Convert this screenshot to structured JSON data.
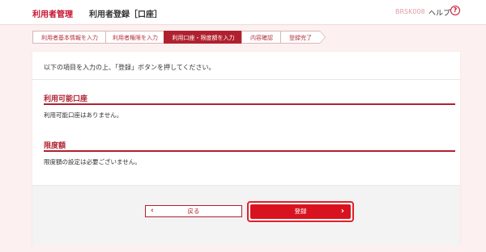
{
  "header": {
    "app_title": "利用者管理",
    "page_title": "利用者登録［口座］",
    "screen_id": "BRSK008",
    "help_label": "ヘルプ",
    "help_icon": "?"
  },
  "steps": [
    {
      "label": "利用者基本情報を入力",
      "active": false
    },
    {
      "label": "利用者権限を入力",
      "active": false
    },
    {
      "label": "利用口座・限度額を入力",
      "active": true
    },
    {
      "label": "内容確認",
      "active": false
    },
    {
      "label": "登録完了",
      "active": false
    }
  ],
  "intro_text": "以下の項目を入力の上、「登録」ボタンを押してください。",
  "sections": {
    "accounts": {
      "title": "利用可能口座",
      "text": "利用可能口座はありません。"
    },
    "limits": {
      "title": "限度額",
      "text": "限度額の設定は必要ございません。"
    }
  },
  "buttons": {
    "back_label": "戻る",
    "back_icon": "‹",
    "register_label": "登録",
    "register_icon": "›"
  },
  "colors": {
    "brand": "#c8102e",
    "section_rule": "#b0212f",
    "register_button": "#d8131f",
    "page_background": "#fdf0f0"
  }
}
